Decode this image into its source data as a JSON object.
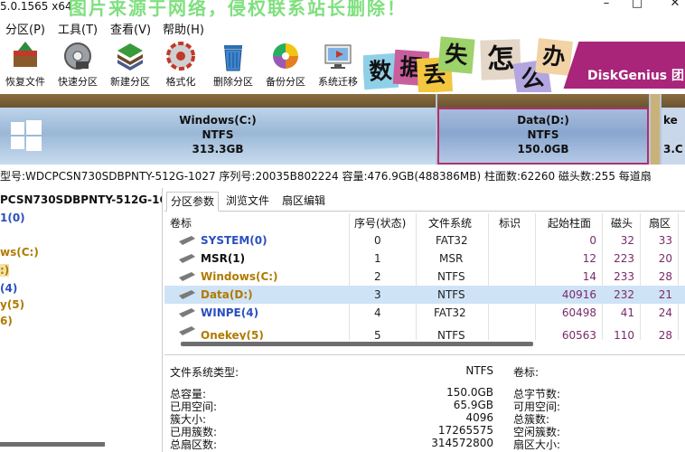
{
  "window": {
    "title": "5.0.1565 x64",
    "watermark": "图片来源于网络，侵权联系站长删除！",
    "controls": [
      "–",
      "□",
      "✕"
    ]
  },
  "menu": [
    "分区(P)",
    "工具(T)",
    "查看(V)",
    "帮助(H)"
  ],
  "toolbar": [
    {
      "label": "恢复文件",
      "icon": "recover-file-icon"
    },
    {
      "label": "快速分区",
      "icon": "quick-partition-icon"
    },
    {
      "label": "新建分区",
      "icon": "new-partition-icon"
    },
    {
      "label": "格式化",
      "icon": "format-icon"
    },
    {
      "label": "删除分区",
      "icon": "delete-partition-icon"
    },
    {
      "label": "备份分区",
      "icon": "backup-partition-icon"
    },
    {
      "label": "系统迁移",
      "icon": "system-migrate-icon"
    }
  ],
  "banner": {
    "chars": [
      "数",
      "据",
      "丢",
      "失",
      "怎",
      "么",
      "办"
    ],
    "brand": "DiskGenius 团"
  },
  "disk_map": [
    {
      "name": "Windows(C:)",
      "fs": "NTFS",
      "size": "313.3GB"
    },
    {
      "name": "Data(D:)",
      "fs": "NTFS",
      "size": "150.0GB"
    },
    {
      "name": "ke",
      "fs": "",
      "size": "3.C"
    }
  ],
  "disk_info": "型号:WDCPCSN730SDBPNTY-512G-1027  序列号:20035B802224  容量:476.9GB(488386MB)  柱面数:62260  磁头数:255  每道扇",
  "tree": {
    "items": [
      {
        "text": "PCSN730SDBPNTY-512G-1C",
        "color": "#111111"
      },
      {
        "text": "1(0)",
        "color": "#2b4fc0"
      },
      {
        "text": "ws(C:)",
        "color": "#b07a00"
      },
      {
        "text": ":)",
        "color": "#b07a00"
      },
      {
        "text": "(4)",
        "color": "#2b4fc0"
      },
      {
        "text": "y(5)",
        "color": "#b07a00"
      },
      {
        "text": "6)",
        "color": "#b07a00"
      }
    ]
  },
  "tabs": [
    "分区参数",
    "浏览文件",
    "扇区编辑"
  ],
  "table": {
    "headers": [
      "卷标",
      "序号(状态)",
      "文件系统",
      "标识",
      "起始柱面",
      "磁头",
      "扇区"
    ],
    "rows": [
      {
        "label": "SYSTEM(0)",
        "index": "0",
        "fs": "FAT32",
        "id": "",
        "cyl": "0",
        "head": "32",
        "sector": "33",
        "color": "#2b4fc0",
        "selected": false
      },
      {
        "label": "MSR(1)",
        "index": "1",
        "fs": "MSR",
        "id": "",
        "cyl": "12",
        "head": "223",
        "sector": "20",
        "color": "#111111",
        "selected": false
      },
      {
        "label": "Windows(C:)",
        "index": "2",
        "fs": "NTFS",
        "id": "",
        "cyl": "14",
        "head": "233",
        "sector": "28",
        "color": "#b07a00",
        "selected": false
      },
      {
        "label": "Data(D:)",
        "index": "3",
        "fs": "NTFS",
        "id": "",
        "cyl": "40916",
        "head": "232",
        "sector": "21",
        "color": "#b07a00",
        "selected": true
      },
      {
        "label": "WINPE(4)",
        "index": "4",
        "fs": "FAT32",
        "id": "",
        "cyl": "60498",
        "head": "41",
        "sector": "24",
        "color": "#2b4fc0",
        "selected": false
      },
      {
        "label": "Onekey(5)",
        "index": "5",
        "fs": "NTFS",
        "id": "",
        "cyl": "60563",
        "head": "110",
        "sector": "28",
        "color": "#b07a00",
        "selected": false
      }
    ]
  },
  "detail": {
    "fs_type_label": "文件系统类型:",
    "fs_type_value": "NTFS",
    "volume_label": "卷标:",
    "left": [
      {
        "label": "总容量:",
        "value": "150.0GB"
      },
      {
        "label": "已用空间:",
        "value": "65.9GB"
      },
      {
        "label": "簇大小:",
        "value": "4096"
      },
      {
        "label": "已用簇数:",
        "value": "17265575"
      },
      {
        "label": "总扇区数:",
        "value": "314572800"
      }
    ],
    "right": [
      "总字节数:",
      "可用空间:",
      "总簇数:",
      "空闲簇数:",
      "扇区大小:"
    ]
  },
  "colors": {
    "titleBlue": "#2b4fc0",
    "volumeOrange": "#b07a00",
    "cylinderPurple": "#7a2a6a",
    "selection": "#cfe3f6",
    "partitionTop": "#7a5f36",
    "dataBorder": "#b03070"
  }
}
